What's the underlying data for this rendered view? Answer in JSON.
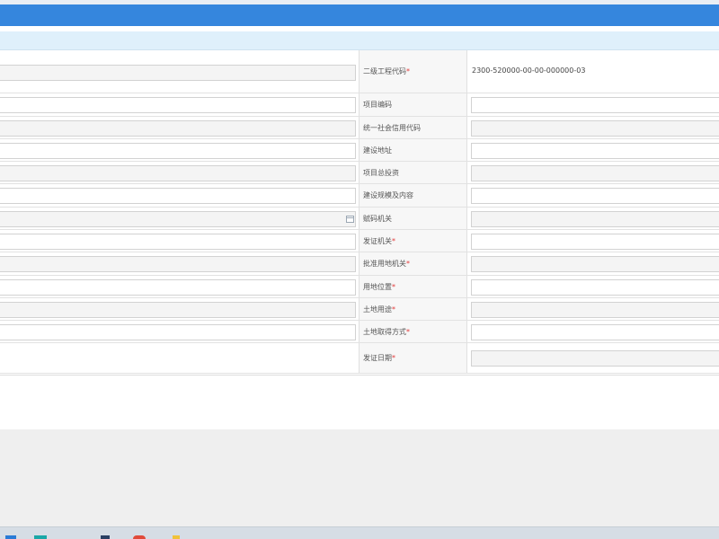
{
  "form": {
    "rows": [
      {
        "label": "二级工程代码",
        "required": true,
        "value": "2300-520000-00-00-000000-03",
        "left_readonly": true,
        "right_readonly": false
      },
      {
        "label": "项目编码",
        "required": false,
        "value": "",
        "left_readonly": false,
        "right_readonly": false
      },
      {
        "label": "统一社会信用代码",
        "required": false,
        "value": "",
        "left_readonly": true,
        "right_readonly": true
      },
      {
        "label": "建设地址",
        "required": false,
        "value": "",
        "left_readonly": false,
        "right_readonly": false
      },
      {
        "label": "项目总投资",
        "required": false,
        "value": "",
        "left_readonly": true,
        "right_readonly": true
      },
      {
        "label": "建设规模及内容",
        "required": false,
        "value": "",
        "left_readonly": false,
        "right_readonly": false
      },
      {
        "label": "赋码机关",
        "required": false,
        "value": "",
        "left_readonly": true,
        "right_readonly": true,
        "left_calendar_icon": true
      },
      {
        "label": "发证机关",
        "required": true,
        "value": "",
        "left_readonly": false,
        "right_readonly": false
      },
      {
        "label": "批准用地机关",
        "required": true,
        "value": "",
        "left_readonly": true,
        "right_readonly": true
      },
      {
        "label": "用地位置",
        "required": true,
        "value": "",
        "left_readonly": false,
        "right_readonly": false
      },
      {
        "label": "土地用途",
        "required": true,
        "value": "",
        "left_readonly": true,
        "right_readonly": true
      },
      {
        "label": "土地取得方式",
        "required": true,
        "value": "",
        "left_readonly": false,
        "right_readonly": false
      },
      {
        "label": "发证日期",
        "required": true,
        "value": "",
        "left_readonly": null,
        "right_readonly": true
      }
    ]
  },
  "colors": {
    "header": "#3586dd",
    "section_strip": "#dff0fb",
    "required_mark": "#e23a3a"
  }
}
